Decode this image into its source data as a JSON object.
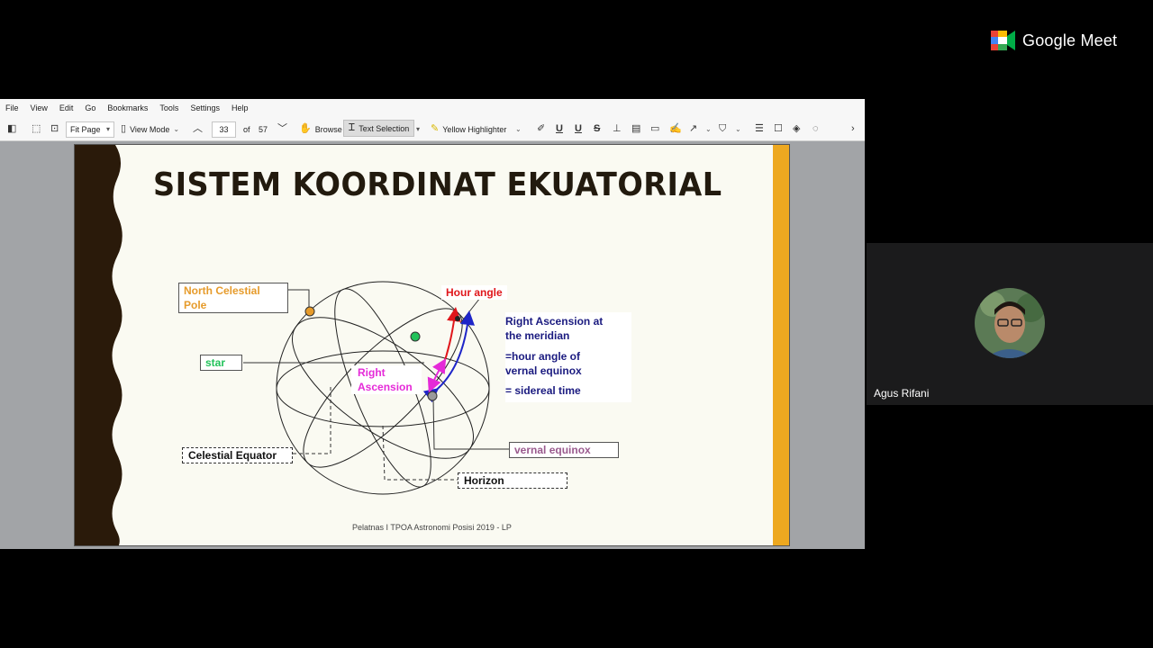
{
  "meet": {
    "brand": "Google Meet",
    "participant_name": "Agus Rifani"
  },
  "menu": [
    "File",
    "View",
    "Edit",
    "Go",
    "Bookmarks",
    "Tools",
    "Settings",
    "Help"
  ],
  "toolbar": {
    "zoom_mode": "Fit Page",
    "view_mode": "View Mode",
    "page_current": "33",
    "page_of": "of",
    "page_total": "57",
    "browse": "Browse",
    "text_selection": "Text Selection",
    "highlighter": "Yellow Highlighter"
  },
  "slide": {
    "title": "SISTEM KOORDINAT EKUATORIAL",
    "footer": "Pelatnas I TPOA Astronomi Posisi 2019 - LP",
    "labels": {
      "north_celestial_pole": "North Celestial Pole",
      "star": "star",
      "celestial_equator": "Celestial Equator",
      "hour_angle": "Hour angle",
      "right_ascension": "Right Ascension",
      "vernal_equinox": "vernal equinox",
      "horizon": "Horizon"
    },
    "ra_notes": {
      "line1": "Right Ascension at",
      "line2": "the meridian",
      "line3": "=hour angle of",
      "line4": "vernal equinox",
      "line5": "= sidereal time"
    }
  },
  "colors": {
    "accent_orange": "#e69b2b",
    "star_green": "#22c25a",
    "hour_angle_red": "#e0161b",
    "ra_magenta": "#e52ad8",
    "ra_blue": "#1e25c8",
    "vernal_mauve": "#9a5a8e",
    "slide_bar": "#eda820"
  }
}
